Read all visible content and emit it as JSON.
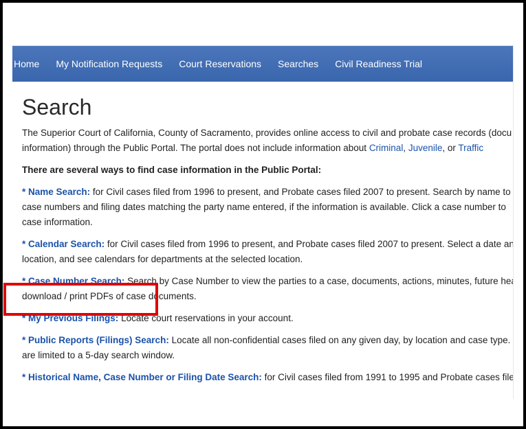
{
  "nav": {
    "items": [
      "Home",
      "My Notification Requests",
      "Court Reservations",
      "Searches",
      "Civil Readiness Trial"
    ]
  },
  "page": {
    "title": "Search",
    "intro_line1": "The Superior Court of California, County of Sacramento, provides online access to civil and probate case records (docu",
    "intro_line2_prefix": "information) through the Public Portal. The portal does not include information about ",
    "link_criminal": "Criminal",
    "comma": ", ",
    "link_juvenile": "Juvenile",
    "or": ", or ",
    "link_traffic": "Traffic",
    "ways_heading": "There are several ways to find case information in the Public Portal:"
  },
  "items": {
    "star": "*",
    "name_search": {
      "link": "Name Search:",
      "line1": " for Civil cases filed from 1996 to present, and Probate cases filed 2007 to present. Search by name to s",
      "line2": "case numbers and filing dates matching the party name entered, if the information is available. Click a case number to",
      "line3": "case information."
    },
    "calendar_search": {
      "link": "Calendar Search:",
      "line1": " for Civil cases filed from 1996 to present, and Probate cases filed 2007 to present. Select a date and",
      "line2": "location, and see calendars for departments at the selected location."
    },
    "case_number_search": {
      "link": "Case Number Search:",
      "line1": " Search by Case Number to view the parties to a case, documents, actions, minutes, future hear",
      "line2": "download / print PDFs of case documents."
    },
    "previous_filings": {
      "link": "My Previous Filings:",
      "line1": " Locate court reservations in your account."
    },
    "public_reports": {
      "link": "Public Reports (Filings) Search:",
      "line1": " Locate all non-confidential cases filed on any given day, by location and case type. Sea",
      "line2": "are limited to a 5-day search window."
    },
    "historical": {
      "link": "Historical Name, Case Number or Filing Date Search:",
      "line1": " for Civil cases filed from 1991 to 1995 and Probate cases filed"
    }
  },
  "colors": {
    "nav_bg": "#3f6cb2",
    "link": "#1a52a8",
    "highlight": "#e00000"
  }
}
